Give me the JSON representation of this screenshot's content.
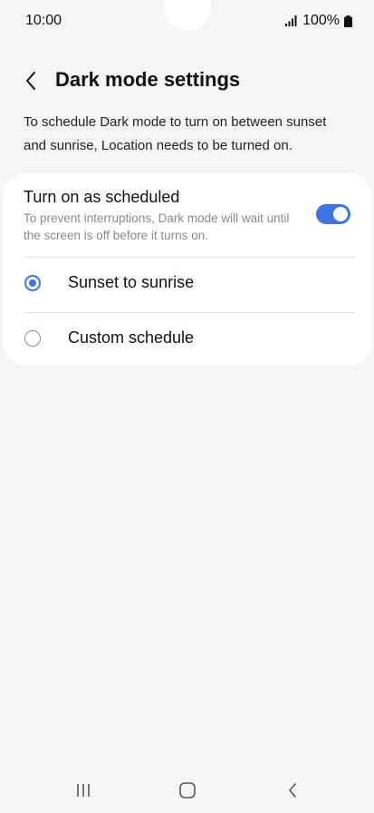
{
  "status_bar": {
    "time": "10:00",
    "battery": "100%",
    "icons": [
      "signal-icon",
      "battery-icon"
    ]
  },
  "header": {
    "back_icon": "chevron-left-icon",
    "title": "Dark mode settings"
  },
  "description": "To schedule Dark mode to turn on between sunset and sunrise, Location needs to be turned on.",
  "schedule": {
    "title": "Turn on as scheduled",
    "subtitle": "To prevent interruptions, Dark mode will wait until the screen is off before it turns on.",
    "enabled": true
  },
  "options": [
    {
      "label": "Sunset to sunrise",
      "selected": true
    },
    {
      "label": "Custom schedule",
      "selected": false
    }
  ],
  "nav_bar": {
    "icons": [
      "recent-apps-icon",
      "home-icon",
      "back-icon"
    ]
  },
  "colors": {
    "accent": "#3e73e8",
    "background": "#f5f5f8",
    "card": "#ffffff",
    "secondary_text": "#8a8a8a"
  }
}
